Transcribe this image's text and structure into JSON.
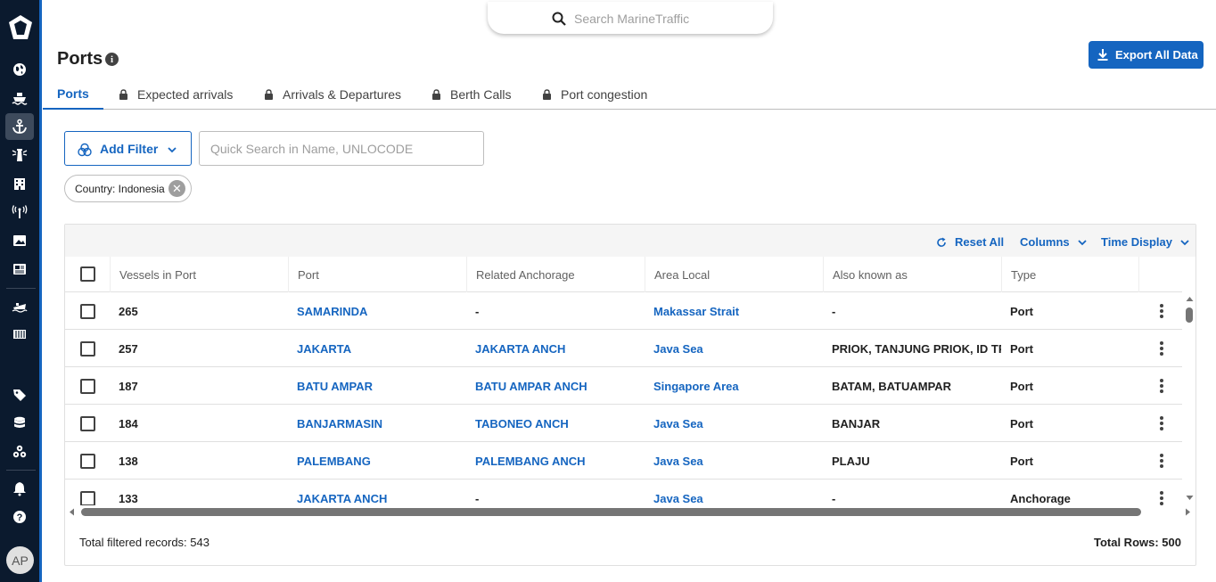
{
  "search": {
    "placeholder": "Search MarineTraffic"
  },
  "page": {
    "title": "Ports",
    "export_label": "Export All Data"
  },
  "tabs": [
    {
      "label": "Ports",
      "locked": false,
      "active": true
    },
    {
      "label": "Expected arrivals",
      "locked": true
    },
    {
      "label": "Arrivals & Departures",
      "locked": true
    },
    {
      "label": "Berth Calls",
      "locked": true
    },
    {
      "label": "Port congestion",
      "locked": true
    }
  ],
  "filters": {
    "add_filter_label": "Add Filter",
    "quick_search_placeholder": "Quick Search in Name, UNLOCODE",
    "chip_label": "Country: Indonesia"
  },
  "toolbar": {
    "reset_label": "Reset All",
    "columns_label": "Columns",
    "time_display_label": "Time Display"
  },
  "table": {
    "columns": [
      "Vessels in Port",
      "Port",
      "Related Anchorage",
      "Area Local",
      "Also known as",
      "Type"
    ],
    "rows": [
      {
        "vessels": "265",
        "port": "SAMARINDA",
        "anchorage": "-",
        "area": "Makassar Strait",
        "aka": "-",
        "type": "Port"
      },
      {
        "vessels": "257",
        "port": "JAKARTA",
        "anchorage": "JAKARTA ANCH",
        "area": "Java Sea",
        "aka": "PRIOK, TANJUNG PRIOK, ID TPP",
        "type": "Port"
      },
      {
        "vessels": "187",
        "port": "BATU AMPAR",
        "anchorage": "BATU AMPAR ANCH",
        "area": "Singapore Area",
        "aka": "BATAM, BATUAMPAR",
        "type": "Port"
      },
      {
        "vessels": "184",
        "port": "BANJARMASIN",
        "anchorage": "TABONEO ANCH",
        "area": "Java Sea",
        "aka": "BANJAR",
        "type": "Port"
      },
      {
        "vessels": "138",
        "port": "PALEMBANG",
        "anchorage": "PALEMBANG ANCH",
        "area": "Java Sea",
        "aka": "PLAJU",
        "type": "Port"
      },
      {
        "vessels": "133",
        "port": "JAKARTA ANCH",
        "anchorage": "-",
        "area": "Java Sea",
        "aka": "-",
        "type": "Anchorage"
      }
    ]
  },
  "footer": {
    "total_filtered": "Total filtered records: 543",
    "total_rows": "Total Rows: 500"
  },
  "user": {
    "initials": "AP"
  },
  "sidebar_icons": [
    "logo-icon",
    "globe-icon",
    "ship-icon",
    "anchor-icon",
    "lighthouse-icon",
    "buildings-icon",
    "antenna-icon",
    "photos-icon",
    "news-icon",
    "vessel-icon",
    "container-icon",
    "tag-icon",
    "database-icon",
    "fleet-icon",
    "bell-icon",
    "help-icon"
  ],
  "colors": {
    "accent": "#1565c0",
    "sidebar": "#0b1a2e"
  }
}
